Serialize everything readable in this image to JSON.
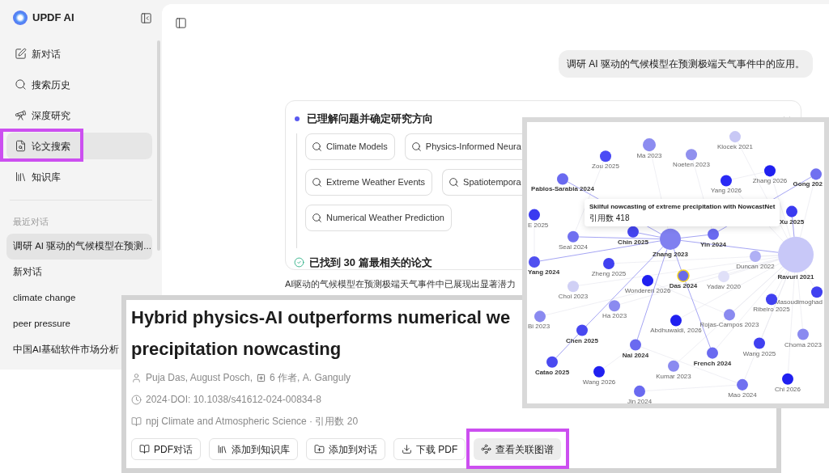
{
  "sidebar": {
    "logo_text": "UPDF AI",
    "nav": [
      {
        "label": "新对话",
        "selected": false,
        "highlighted": false
      },
      {
        "label": "搜索历史",
        "selected": false,
        "highlighted": false
      },
      {
        "label": "深度研究",
        "selected": false,
        "highlighted": false
      },
      {
        "label": "论文搜索",
        "selected": true,
        "highlighted": true
      },
      {
        "label": "知识库",
        "selected": false,
        "highlighted": false
      }
    ],
    "recent_heading": "最近对话",
    "recent": [
      {
        "label": "调研 AI 驱动的气候模型在预测...",
        "selected": true
      },
      {
        "label": "新对话",
        "selected": false
      },
      {
        "label": "climate change",
        "selected": false
      },
      {
        "label": "peer pressure",
        "selected": false
      },
      {
        "label": "中国AI基础软件市场分析",
        "selected": false
      }
    ]
  },
  "chat": {
    "user_message": "调研 AI 驱动的气候模型在预测极端天气事件中的应用。"
  },
  "research": {
    "title": "已理解问题并确定研究方向",
    "chip_rows": [
      [
        "Climate Models",
        "Physics-Informed Neura"
      ],
      [
        "Extreme Weather Events",
        "Spatiotempora"
      ],
      [
        "Numerical Weather Prediction"
      ]
    ],
    "result": "已找到 30 篇最相关的论文"
  },
  "answer_text": "AI驱动的气候模型在预测极端天气事件中已展现出显著潜力",
  "paper": {
    "title_lines": [
      "Hybrid physics-AI outperforms numerical we",
      "precipitation nowcasting"
    ],
    "authors": "Puja Das, August Posch,",
    "more_authors": "6 作者, A. Ganguly",
    "doi": "2024·DOI: 10.1038/s41612-024-00834-8",
    "journal": "npj Climate and Atmospheric Science · 引用数 20",
    "actions": [
      {
        "label": "PDF对话",
        "selected": false,
        "highlighted": false
      },
      {
        "label": "添加到知识库",
        "selected": false,
        "highlighted": false
      },
      {
        "label": "添加到对话",
        "selected": false,
        "highlighted": false
      },
      {
        "label": "下载 PDF",
        "selected": false,
        "highlighted": false
      },
      {
        "label": "查看关联图谱",
        "selected": true,
        "highlighted": true
      }
    ]
  },
  "graph": {
    "tooltip": {
      "title": "Skilful nowcasting of extreme precipitation with NowcastNet",
      "citations": "引用数 418"
    },
    "nodes": [
      {
        "label": "Klocek 2021",
        "color": "#c8c8f5",
        "linked": false,
        "selected": false
      },
      {
        "label": "Ma 2023",
        "color": "#8c8cf0",
        "linked": false,
        "selected": false
      },
      {
        "label": "Noeten 2023",
        "color": "#9090ee",
        "linked": false,
        "selected": false
      },
      {
        "label": "Zou 2025",
        "color": "#4a4af5",
        "linked": false,
        "selected": false
      },
      {
        "label": "Zhang 2026",
        "color": "#2020f0",
        "linked": false,
        "selected": false
      },
      {
        "label": "Gong 202",
        "color": "#7070f0",
        "linked": true,
        "selected": false
      },
      {
        "label": "Yang 2026",
        "color": "#2a2af5",
        "linked": false,
        "selected": false
      },
      {
        "label": "Pablos-Sarabia 2024",
        "color": "#6a6af0",
        "linked": true,
        "selected": false
      },
      {
        "label": "E 2025",
        "color": "#3a3af0",
        "linked": false,
        "selected": false
      },
      {
        "label": "Xu 2025",
        "color": "#3a3af0",
        "linked": true,
        "selected": false
      },
      {
        "label": "Chin 2025",
        "color": "#4545f0",
        "linked": true,
        "selected": false
      },
      {
        "label": "Seal 2024",
        "color": "#7070f0",
        "linked": false,
        "selected": false
      },
      {
        "label": "Zhang 2023",
        "color": "#8080f0",
        "linked": true,
        "selected": false
      },
      {
        "label": "Yin 2024",
        "color": "#6a6af0",
        "linked": true,
        "selected": false
      },
      {
        "label": "Ravuri 2021",
        "color": "#c8c8f8",
        "linked": true,
        "selected": false
      },
      {
        "label": "Duncan 2022",
        "color": "#b0b0f5",
        "linked": false,
        "selected": false
      },
      {
        "label": "Yang 2024",
        "color": "#5050f0",
        "linked": true,
        "selected": false
      },
      {
        "label": "Zheng 2025",
        "color": "#4040f0",
        "linked": false,
        "selected": false
      },
      {
        "label": "Das 2024",
        "color": "#6a6ae8",
        "linked": true,
        "selected": true
      },
      {
        "label": "Wonderen 2026",
        "color": "#2020f0",
        "linked": false,
        "selected": false
      },
      {
        "label": "Yadav 2020",
        "color": "#e0e0f8",
        "linked": false,
        "selected": false
      },
      {
        "label": "Choi 2023",
        "color": "#d0d0f5",
        "linked": false,
        "selected": false
      },
      {
        "label": "Masoudimoghad",
        "color": "#4040f0",
        "linked": false,
        "selected": false
      },
      {
        "label": "Ribeiro 2025",
        "color": "#4040f0",
        "linked": false,
        "selected": false
      },
      {
        "label": "Ha 2023",
        "color": "#8a8af0",
        "linked": false,
        "selected": false
      },
      {
        "label": "Bi 2023",
        "color": "#8a8af0",
        "linked": false,
        "selected": false
      },
      {
        "label": "Rojas-Campos 2023",
        "color": "#8a8af0",
        "linked": false,
        "selected": false
      },
      {
        "label": "Abdhuwaidi, 2026",
        "color": "#2020f0",
        "linked": false,
        "selected": false
      },
      {
        "label": "Chen 2025",
        "color": "#4848f0",
        "linked": true,
        "selected": false
      },
      {
        "label": "Choma 2023",
        "color": "#8a8af0",
        "linked": false,
        "selected": false
      },
      {
        "label": "Nai 2024",
        "color": "#6a6af0",
        "linked": true,
        "selected": false
      },
      {
        "label": "Wang 2025",
        "color": "#4040f0",
        "linked": false,
        "selected": false
      },
      {
        "label": "French 2024",
        "color": "#6a6af0",
        "linked": true,
        "selected": false
      },
      {
        "label": "Catao 2025",
        "color": "#4a4af0",
        "linked": true,
        "selected": false
      },
      {
        "label": "Kumar 2023",
        "color": "#8a8af0",
        "linked": false,
        "selected": false
      },
      {
        "label": "Wang 2026",
        "color": "#2020f0",
        "linked": false,
        "selected": false
      },
      {
        "label": "Chi 2026",
        "color": "#2020f0",
        "linked": false,
        "selected": false
      },
      {
        "label": "Mao 2024",
        "color": "#7070f0",
        "linked": false,
        "selected": false
      },
      {
        "label": "Jin 2024",
        "color": "#6a6af0",
        "linked": false,
        "selected": false
      }
    ]
  }
}
